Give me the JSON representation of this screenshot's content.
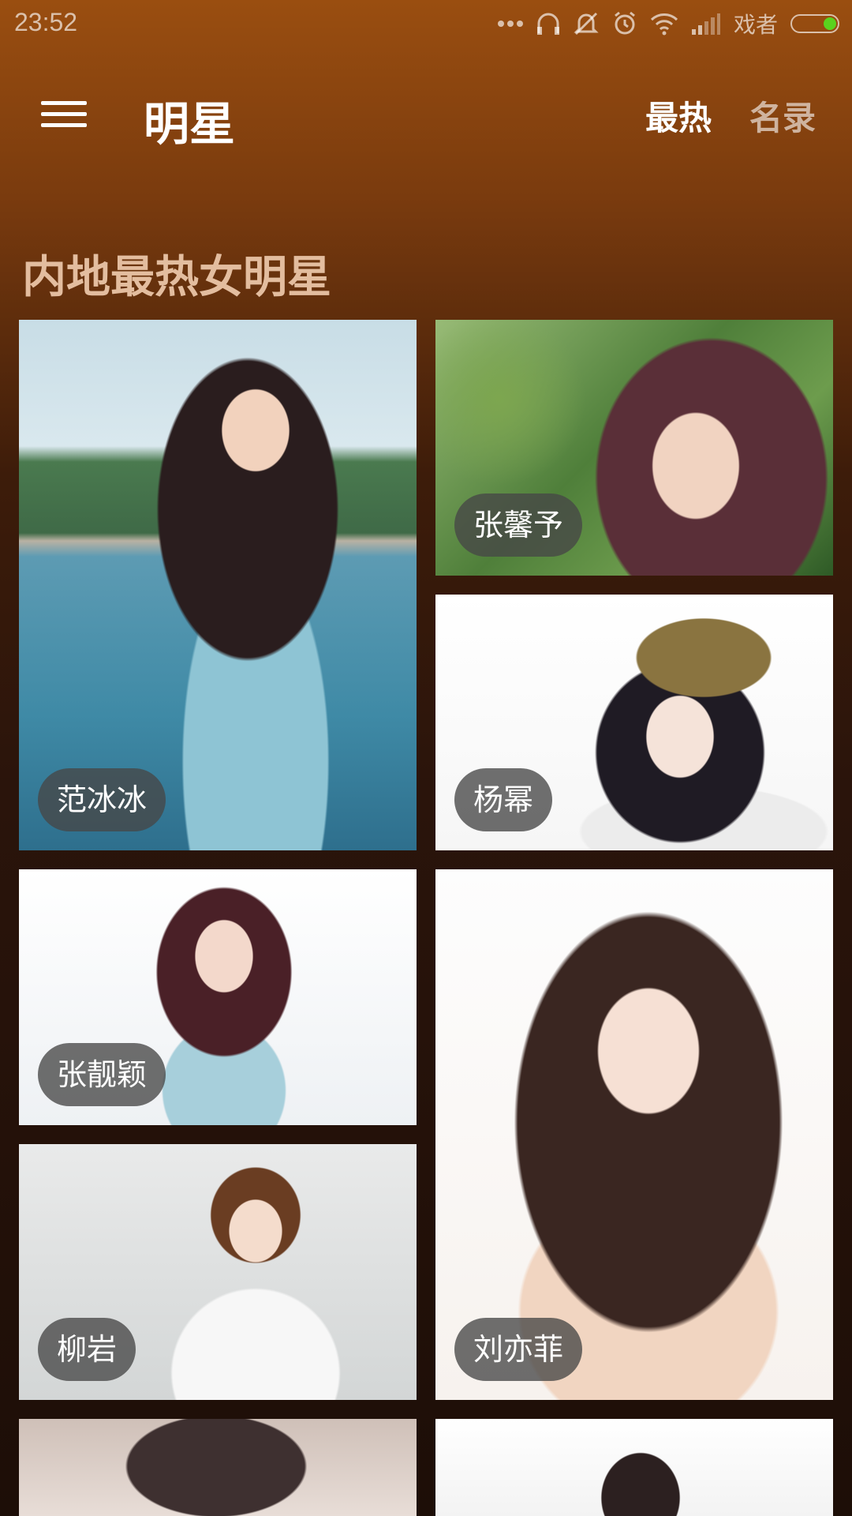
{
  "status_bar": {
    "time": "23:52",
    "carrier": "戏者",
    "icons": [
      "more-dots-icon",
      "headphone-icon",
      "mute-icon",
      "alarm-icon",
      "wifi-icon",
      "signal-icon",
      "battery-icon"
    ]
  },
  "app_bar": {
    "title": "明星",
    "tabs": [
      {
        "label": "最热",
        "active": true
      },
      {
        "label": "名录",
        "active": false
      }
    ]
  },
  "section": {
    "title": "内地最热女明星"
  },
  "grid": {
    "items": [
      {
        "name": "范冰冰"
      },
      {
        "name": "张馨予"
      },
      {
        "name": "杨幂"
      },
      {
        "name": "张靓颖"
      },
      {
        "name": "柳岩"
      },
      {
        "name": "刘亦菲"
      },
      {
        "name": ""
      },
      {
        "name": ""
      }
    ]
  },
  "colors": {
    "accent_bg_top": "#9a4e10",
    "accent_bg_bottom": "#1d0e07",
    "section_title": "#e3bd9f",
    "battery_fill": "#5ad21e"
  }
}
